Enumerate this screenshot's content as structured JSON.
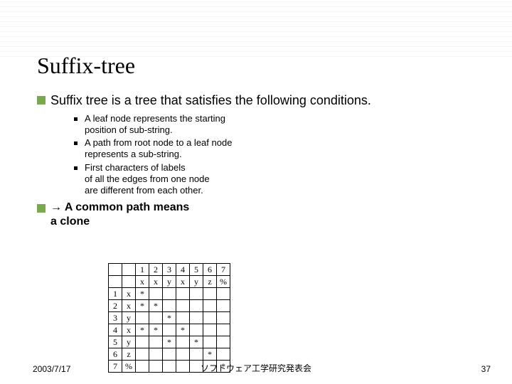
{
  "title": "Suffix-tree",
  "main_point": "Suffix tree is a tree that satisfies the following conditions.",
  "sub_points": [
    "A leaf node represents the starting\nposition of sub-string.",
    "A path from root node to a leaf node\nrepresents a sub-string.",
    "First characters of labels\nof all the edges from one node\nare different from each other."
  ],
  "conclusion": "→ A common path means\na clone",
  "table": {
    "col_headers": [
      "1",
      "2",
      "3",
      "4",
      "5",
      "6",
      "7"
    ],
    "sub_headers": [
      "x",
      "x",
      "y",
      "x",
      "y",
      "z",
      "%"
    ],
    "rows": [
      {
        "h": "1",
        "s": "x",
        "cells": [
          "*",
          "",
          "",
          "",
          "",
          "",
          ""
        ]
      },
      {
        "h": "2",
        "s": "x",
        "cells": [
          "*",
          "*",
          "",
          "",
          "",
          "",
          ""
        ]
      },
      {
        "h": "3",
        "s": "y",
        "cells": [
          "",
          "",
          "*",
          "",
          "",
          "",
          ""
        ]
      },
      {
        "h": "4",
        "s": "x",
        "cells": [
          "*",
          "*",
          "",
          "*",
          "",
          "",
          ""
        ]
      },
      {
        "h": "5",
        "s": "y",
        "cells": [
          "",
          "",
          "*",
          "",
          "*",
          "",
          ""
        ]
      },
      {
        "h": "6",
        "s": "z",
        "cells": [
          "",
          "",
          "",
          "",
          "",
          "*",
          ""
        ]
      },
      {
        "h": "7",
        "s": "%",
        "cells": [
          "",
          "",
          "",
          "",
          "",
          "",
          "*"
        ]
      }
    ]
  },
  "footer": {
    "date": "2003/7/17",
    "center": "ソフトウェア工学研究発表会",
    "page": "37"
  }
}
